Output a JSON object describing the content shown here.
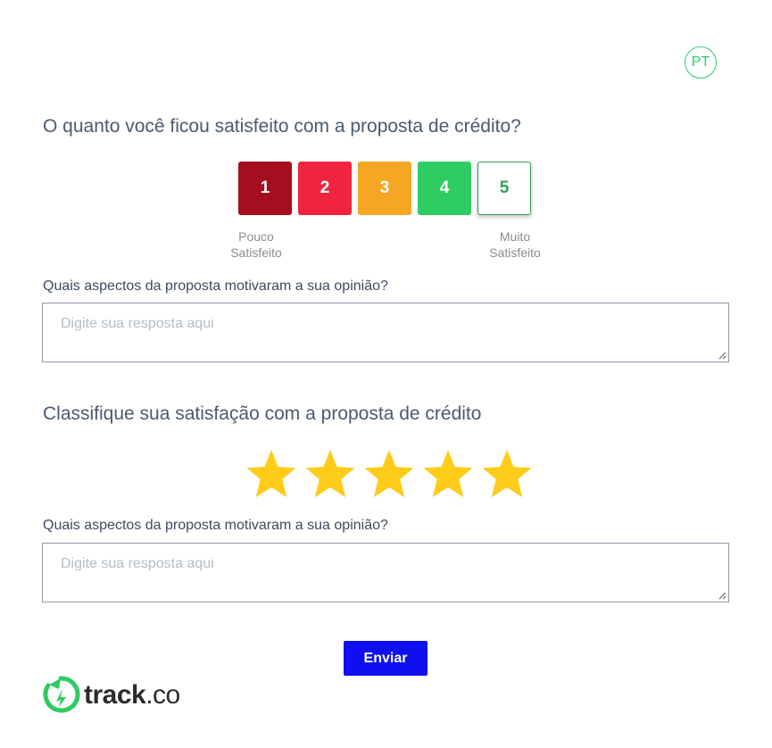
{
  "language_badge": "PT",
  "question1": {
    "title": "O quanto você ficou satisfeito com a proposta de crédito?",
    "scale": [
      {
        "label": "1",
        "color": "#a50e1e"
      },
      {
        "label": "2",
        "color": "#f0243f"
      },
      {
        "label": "3",
        "color": "#f5a623"
      },
      {
        "label": "4",
        "color": "#2ecc62"
      },
      {
        "label": "5",
        "color": "#ffffff",
        "selected": true
      }
    ],
    "low_label_line1": "Pouco",
    "low_label_line2": "Satisfeito",
    "high_label_line1": "Muito",
    "high_label_line2": "Satisfeito",
    "field_label": "Quais aspectos da proposta motivaram a sua opinião?",
    "placeholder": "Digite sua resposta aqui",
    "value": ""
  },
  "question2": {
    "title": "Classifique sua satisfação com a proposta de crédito",
    "rating": 5,
    "max_rating": 5,
    "star_color": "#ffcc1a",
    "field_label": "Quais aspectos da proposta motivaram a sua opinião?",
    "placeholder": "Digite sua resposta aqui",
    "value": ""
  },
  "submit_label": "Enviar",
  "brand": {
    "name": "track",
    "suffix": ".co",
    "accent": "#2ecc62"
  }
}
